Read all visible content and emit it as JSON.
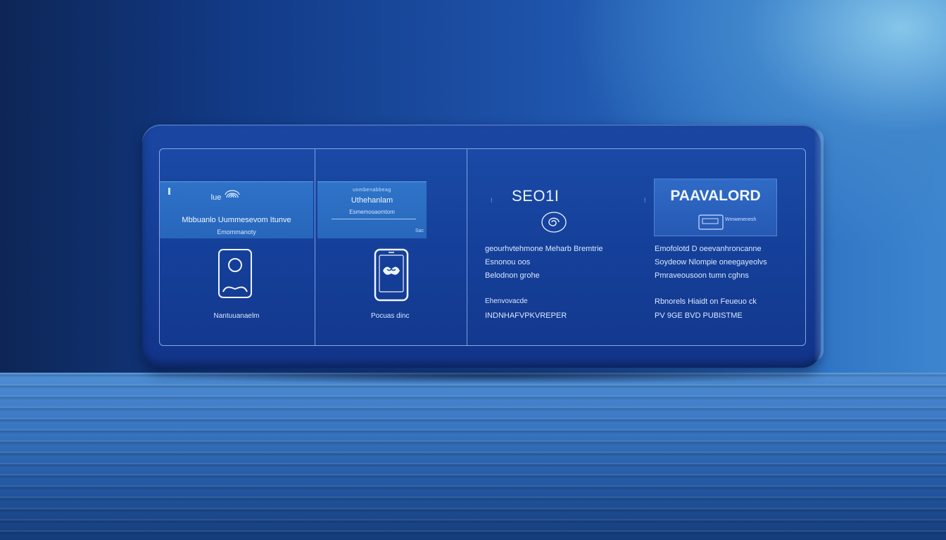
{
  "panel1": {
    "header_title": "lue",
    "header_subtitle": "Mbbuanlo Uummesevom Itunve",
    "header_note": "Emommanoty",
    "caption": "Nantuuanaelm"
  },
  "panel2": {
    "header_top": "unmbenabbeag",
    "header_title": "Uthehanlam",
    "header_subtitle": "Esmemosaomtom",
    "header_tiny": "Sac",
    "caption": "Pocuas dinc"
  },
  "panel3": {
    "title": "SEO1I",
    "marker": "⁞",
    "lines": [
      "geourhvtehmone Meharb Bremtrie",
      "Esnonou oos",
      "Belodnon grohe"
    ],
    "lines2": [
      "Ehenvovacde",
      "INDNHAFVPKVREPER"
    ]
  },
  "panel4": {
    "title": "PAAVALORD",
    "marker": "⁞",
    "card_text": "Wmwenenesh",
    "lines": [
      "Emofolotd D oeevanhroncanne",
      "Soydeow Nlompie oneegayeolvs",
      "Pmraveousoon tumn cghns"
    ],
    "lines2": [
      "Rbnorels Hiaidt on Feueuo ck",
      "PV 9GE BVD PUBISTME"
    ]
  },
  "colors": {
    "device": "#163f98",
    "screen_border": "#aac8ff",
    "header": "#2e72c8"
  }
}
